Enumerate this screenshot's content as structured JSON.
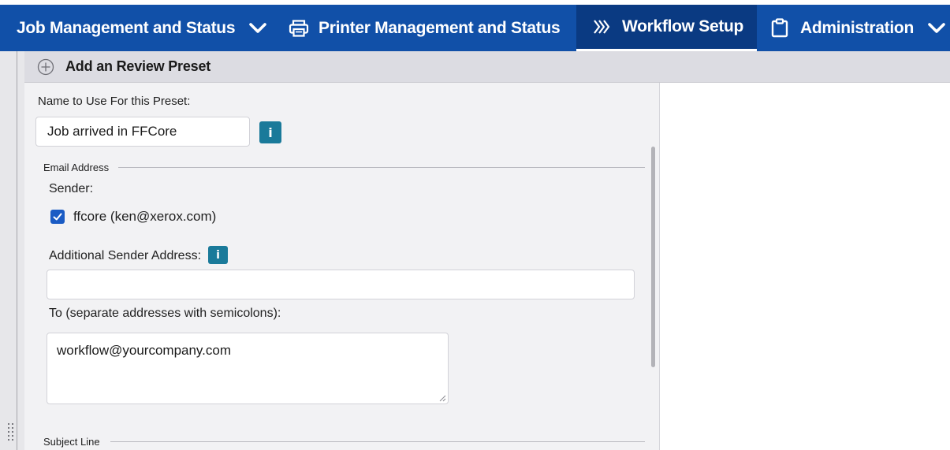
{
  "nav": {
    "job": "Job Management and Status",
    "printer": "Printer Management and Status",
    "workflow": "Workflow Setup",
    "admin": "Administration"
  },
  "panel": {
    "title": "Add an Review Preset"
  },
  "form": {
    "preset_name_label": "Name to Use For this Preset:",
    "preset_name_value": "Job arrived in FFCore",
    "info_glyph": "i",
    "email_section": "Email Address",
    "sender_label": "Sender:",
    "sender_option": "ffcore (ken@xerox.com)",
    "sender_checked": true,
    "additional_sender_label": "Additional Sender Address:",
    "additional_sender_value": "",
    "to_label": "To (separate addresses with semicolons):",
    "to_value": "workflow@yourcompany.com",
    "subject_section": "Subject Line"
  },
  "colors": {
    "nav_bg": "#1150a8",
    "nav_active_bg": "#0a3a82",
    "info_button": "#1a7a9a",
    "checkbox": "#1a5bc4"
  },
  "icons": {
    "job_chevron": "chevron-down-icon",
    "printer": "printer-icon",
    "workflow": "workflow-chevrons-icon",
    "admin": "clipboard-icon",
    "admin_chevron": "chevron-down-icon",
    "add": "plus-circle-icon",
    "info": "info-icon",
    "check": "checkmark-icon",
    "grip": "drag-handle-icon"
  }
}
